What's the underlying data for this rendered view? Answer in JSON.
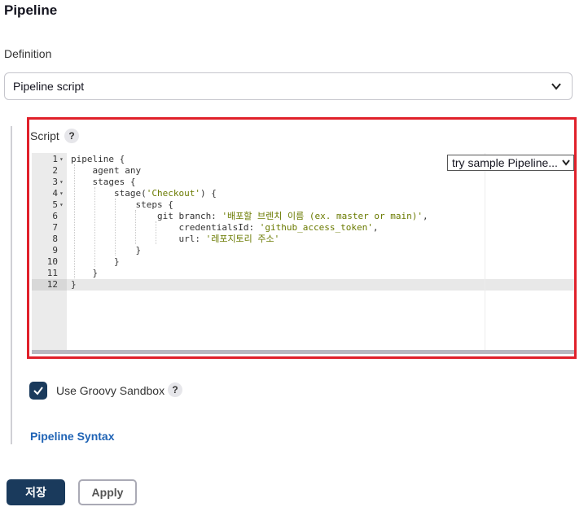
{
  "section": {
    "title": "Pipeline"
  },
  "definition": {
    "label": "Definition",
    "selected": "Pipeline script"
  },
  "script": {
    "label": "Script",
    "help": "?",
    "sample_select": "try sample Pipeline...",
    "lines": [
      {
        "num": "1",
        "fold": "▾",
        "text": "pipeline {"
      },
      {
        "num": "2",
        "fold": "",
        "text": "    agent any"
      },
      {
        "num": "3",
        "fold": "▾",
        "text": "    stages {"
      },
      {
        "num": "4",
        "fold": "▾",
        "text": "        stage('Checkout') {"
      },
      {
        "num": "5",
        "fold": "▾",
        "text": "            steps {"
      },
      {
        "num": "6",
        "fold": "",
        "text": "                git branch: '배포할 브렌치 이름 (ex. master or main)',"
      },
      {
        "num": "7",
        "fold": "",
        "text": "                    credentialsId: 'github_access_token',"
      },
      {
        "num": "8",
        "fold": "",
        "text": "                    url: '레포지토리 주소'"
      },
      {
        "num": "9",
        "fold": "",
        "text": "            }"
      },
      {
        "num": "10",
        "fold": "",
        "text": "        }"
      },
      {
        "num": "11",
        "fold": "",
        "text": "    }"
      },
      {
        "num": "12",
        "fold": "",
        "text": "}"
      }
    ]
  },
  "sandbox": {
    "label": "Use Groovy Sandbox",
    "checked": true,
    "help": "?"
  },
  "syntax_link": "Pipeline Syntax",
  "buttons": {
    "save": "저장",
    "apply": "Apply"
  },
  "colors": {
    "primary": "#1a3a5c",
    "link": "#1f63b5",
    "highlight": "#e0202a",
    "string": "#6a7a00"
  }
}
